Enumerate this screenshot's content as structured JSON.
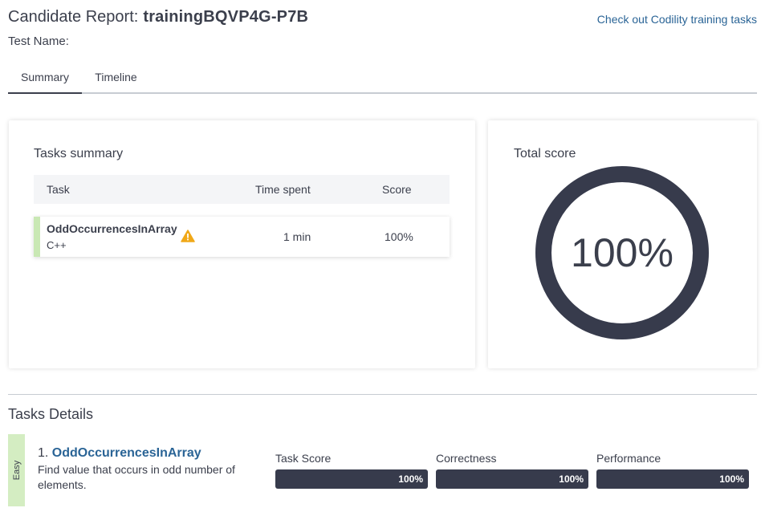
{
  "header": {
    "title_label": "Candidate Report:",
    "title_value": "trainingBQVP4G-P7B",
    "training_link": "Check out Codility training tasks",
    "test_name_label": "Test Name:"
  },
  "tabs": [
    {
      "label": "Summary",
      "active": true
    },
    {
      "label": "Timeline",
      "active": false
    }
  ],
  "tasks_summary": {
    "title": "Tasks summary",
    "columns": [
      "Task",
      "Time spent",
      "Score"
    ],
    "rows": [
      {
        "name": "OddOccurrencesInArray",
        "language": "C++",
        "warning_icon": "warning-triangle-icon",
        "time_spent": "1 min",
        "score": "100%"
      }
    ]
  },
  "total_score": {
    "title": "Total score",
    "value_text": "100%",
    "value": 100,
    "ring_color": "#373b4c"
  },
  "tasks_details": {
    "title": "Tasks Details",
    "items": [
      {
        "difficulty": "Easy",
        "difficulty_color": "#d4edc2",
        "number": "1.",
        "name": "OddOccurrencesInArray",
        "description": "Find value that occurs in odd number of elements.",
        "metrics": [
          {
            "label": "Task Score",
            "value_text": "100%",
            "value": 100
          },
          {
            "label": "Correctness",
            "value_text": "100%",
            "value": 100
          },
          {
            "label": "Performance",
            "value_text": "100%",
            "value": 100
          }
        ]
      }
    ]
  },
  "colors": {
    "accent_link": "#2a6496",
    "bar_dark": "#373b4c",
    "task_row_marker": "#c9e8b4",
    "warning": "#f0a818"
  }
}
